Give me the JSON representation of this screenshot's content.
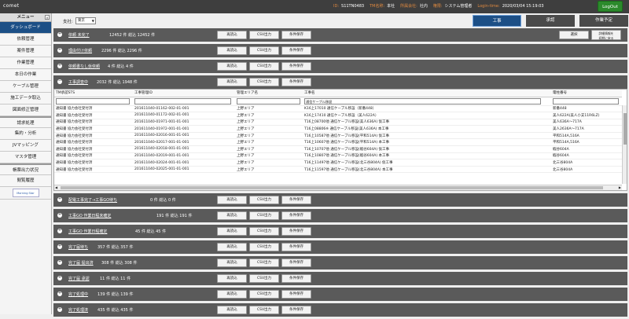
{
  "header": {
    "brand": "comet",
    "info": [
      {
        "label": "ID:",
        "value": "S11TN0483"
      },
      {
        "label": "TM名称:",
        "value": "本社"
      },
      {
        "label": "所属会社:",
        "value": "社内"
      },
      {
        "label": "権限:",
        "value": "システム管理者"
      },
      {
        "label": "Login-time:",
        "value": "2020/03/04 15:19:03"
      }
    ],
    "logout": "LogOut"
  },
  "sidebar": {
    "title": "メニュー",
    "close": "×",
    "items": [
      {
        "label": "ダッシュボード",
        "active": true
      },
      {
        "label": "依頼管理"
      },
      {
        "label": "案件管理"
      },
      {
        "label": "作業管理"
      },
      {
        "label": "本日の作業"
      },
      {
        "label": "ケーブル管理"
      },
      {
        "label": "施工データ取込"
      },
      {
        "label": "図面修正管理"
      },
      {
        "label": "請求処理",
        "sep": true
      },
      {
        "label": "集約・分析"
      },
      {
        "label": "JVマッピング"
      },
      {
        "label": "マスタ管理"
      },
      {
        "label": "帳票出力状況",
        "sep": true
      },
      {
        "label": "閲覧履歴"
      }
    ],
    "logo": "Morning Star"
  },
  "filter": {
    "label": "支社:",
    "value": "東京"
  },
  "tabs": [
    "工事",
    "承認",
    "作業予定"
  ],
  "buttons": {
    "reload": "再読込",
    "csv": "CSV出力",
    "condition": "条件保存",
    "select": "選択",
    "init_search": "詳細情報を\n初期に戻る"
  },
  "sections": [
    {
      "title": "依頼 未完了",
      "count": "12452 件 総込 12452 件",
      "toggle": "+",
      "extra": true
    },
    {
      "title": "理由付け依頼",
      "count": "2296 件 総込 2296 件",
      "toggle": "+"
    },
    {
      "title": "依頼書なし仮依頼",
      "count": "4 件 総込 4 件",
      "toggle": "+"
    },
    {
      "title": "工事調査中",
      "count": "2032 件 総込 1948 件",
      "toggle": "−",
      "expanded": true
    },
    {
      "title": "配電工事完了→工事GO待ち",
      "count": "0 件 総込 0 件",
      "toggle": "+"
    },
    {
      "title": "工事GO 作業日程未確定",
      "count": "191 件 総込 191 件",
      "toggle": "+"
    },
    {
      "title": "工事GO 作業日程確定",
      "count": "45 件 総込 45 件",
      "toggle": "+"
    },
    {
      "title": "完了届待ち",
      "count": "357 件 総込 357 件",
      "toggle": "+"
    },
    {
      "title": "完了届 提出済",
      "count": "308 件 総込 308 件",
      "toggle": "+"
    },
    {
      "title": "完了届 承認",
      "count": "11 件 総込 11 件",
      "toggle": "+"
    },
    {
      "title": "完了処理中",
      "count": "139 件 総込 139 件",
      "toggle": "+"
    },
    {
      "title": "完了処理済",
      "count": "435 件 総込 435 件",
      "toggle": "+"
    }
  ],
  "table": {
    "columns": [
      "TM承認STS",
      "工事管理ID",
      "管理エリア名",
      "工事名",
      "電柱番号"
    ],
    "filter_values": [
      "",
      "",
      "",
      "通信ケーブル移設",
      ""
    ],
    "rows": [
      [
        "通知書 協力会社受付済",
        "201611040-01162-002-01-001",
        "上野エリア",
        "K16上17010 通信ケーブル移設（新番448）",
        "新番448"
      ],
      [
        "通知書 協力会社受付済",
        "201611040-01172-002-01-001",
        "上野エリア",
        "K16上17410 通信ケーブル移設（美人622A）",
        "美人622A(美人小支11R6LZ)"
      ],
      [
        "通知書 協力会社受付済",
        "201611040-01971-001-01-001",
        "上野エリア",
        "T16上08700他 通信ケーブル移設(美人636A) 仮工事",
        "美人636A～717A"
      ],
      [
        "通知書 協力会社受付済",
        "201611040-01972-001-01-001",
        "上野エリア",
        "T16上08806※ 通信ケーブル移設(美人636A) 本工事",
        "美人2636A～717A"
      ],
      [
        "通知書 協力会社受付済",
        "201611040-02016-001-01-001",
        "上野エリア",
        "T16上10587他 通信ケーブル移設(平和514A) 仮工事",
        "平和514A,516A"
      ],
      [
        "通知書 協力会社受付済",
        "201611040-02017-001-01-001",
        "上野エリア",
        "T16上10607他 通信ケーブル移設(平和514A) 本工事",
        "平和514A,516A"
      ],
      [
        "通知書 協力会社受付済",
        "201611040-02018-001-01-001",
        "上野エリア",
        "T16上10707他 通信ケーブル移設(蝦谷604A) 仮工事",
        "蝦谷604A"
      ],
      [
        "通知書 協力会社受付済",
        "201611040-02019-001-01-001",
        "上野エリア",
        "T16上10807他 通信ケーブル移設(蝦谷604A) 本工事",
        "蝦谷604A"
      ],
      [
        "通知書 協力会社受付済",
        "201611040-02024-001-01-001",
        "上野エリア",
        "T16上11497他 通信ケーブル移設(北三谷804A) 仮工事",
        "北三谷804A"
      ],
      [
        "通知書 協力会社受付済",
        "201611040-02025-001-01-001",
        "上野エリア",
        "T16上11597他 通信ケーブル移設(北三谷804A) 本工事",
        "北三谷804A"
      ]
    ]
  }
}
